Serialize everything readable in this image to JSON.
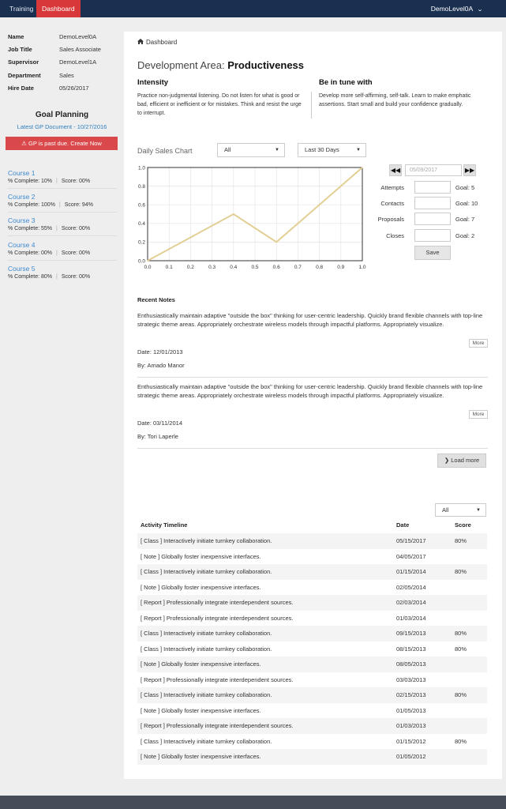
{
  "nav": {
    "tabs": [
      "Training",
      "Dashboard"
    ],
    "user": "DemoLevel0A"
  },
  "profile": [
    {
      "label": "Name",
      "value": "DemoLevel0A"
    },
    {
      "label": "Job Title",
      "value": "Sales Associate"
    },
    {
      "label": "Supervisor",
      "value": "DemoLevel1A"
    },
    {
      "label": "Department",
      "value": "Sales"
    },
    {
      "label": "Hire Date",
      "value": "05/26/2017"
    }
  ],
  "goal_planning": {
    "title": "Goal Planning",
    "latest_doc": "Latest GP Document - 10/27/2016",
    "alert": "GP is past due. Create Now"
  },
  "courses": [
    {
      "name": "Course 1",
      "complete": "% Complete: 10%",
      "score": "Score: 00%"
    },
    {
      "name": "Course 2",
      "complete": "% Complete: 100%",
      "score": "Score: 94%"
    },
    {
      "name": "Course 3",
      "complete": "% Complete: 55%",
      "score": "Score: 00%"
    },
    {
      "name": "Course 4",
      "complete": "% Complete: 00%",
      "score": "Score: 00%"
    },
    {
      "name": "Course 5",
      "complete": "% Complete: 80%",
      "score": "Score: 00%"
    }
  ],
  "breadcrumb": "Dashboard",
  "dev_area": {
    "prefix": "Development Area:",
    "name": "Productiveness"
  },
  "columns": [
    {
      "heading": "Intensity",
      "text": "Practice non-judgmental listening. Do not listen for what is good or bad, efficient or inefficient or for mistakes. Think and resist the urge to interrupt."
    },
    {
      "heading": "Be in tune with",
      "text": "Develop more self-affirming, self-talk. Learn to make emphatic assertions. Start small and build your confidence gradually."
    }
  ],
  "chart_panel": {
    "title": "Daily Sales Chart",
    "filter_value": "All",
    "range_value": "Last 30 Days"
  },
  "chart_data": {
    "type": "line",
    "x": [
      0.0,
      0.4,
      0.6,
      1.0
    ],
    "series": [
      {
        "values": [
          0.0,
          0.5,
          0.2,
          1.0
        ],
        "color": "#e2cf94"
      }
    ],
    "xticks": [
      "0.0",
      "0.1",
      "0.2",
      "0.3",
      "0.4",
      "0.5",
      "0.6",
      "0.7",
      "0.8",
      "0.9",
      "1.0"
    ],
    "yticks": [
      "0.0",
      "0.2",
      "0.4",
      "0.6",
      "0.8",
      "1.0"
    ],
    "xlim": [
      0,
      1
    ],
    "ylim": [
      0,
      1
    ],
    "grid": true
  },
  "goals": {
    "date": "05/09/2017",
    "rows": [
      {
        "label": "Attempts",
        "goal": "Goal: 5"
      },
      {
        "label": "Contacts",
        "goal": "Goal: 10"
      },
      {
        "label": "Proposals",
        "goal": "Goal: 7"
      },
      {
        "label": "Closes",
        "goal": "Goal: 2"
      }
    ],
    "save_label": "Save"
  },
  "notes": {
    "title": "Recent Notes",
    "items": [
      {
        "text": "Enthusiastically maintain adaptive \"outside the box\" thinking for user-centric leadership. Quickly brand flexible channels with top-line strategic theme areas. Appropriately orchestrate wireless models through impactful platforms. Appropriately visualize.",
        "date": "Date: 12/01/2013",
        "by": "By: Amado Manor"
      },
      {
        "text": "Enthusiastically maintain adaptive \"outside the box\" thinking for user-centric leadership. Quickly brand flexible channels with top-line strategic theme areas. Appropriately orchestrate wireless models through impactful platforms. Appropriately visualize.",
        "date": "Date: 03/11/2014",
        "by": "By: Tori Laperle"
      }
    ],
    "more_label": "More",
    "load_more_label": "Load more"
  },
  "timeline": {
    "filter_value": "All",
    "headers": [
      "Activity Timeline",
      "Date",
      "Score"
    ],
    "rows": [
      [
        "[ Class ] Interactively initiate turnkey collaboration.",
        "05/15/2017",
        "80%"
      ],
      [
        "[ Note ] Globally foster inexpensive interfaces.",
        "04/05/2017",
        ""
      ],
      [
        "[ Class ] Interactively initiate turnkey collaboration.",
        "01/15/2014",
        "80%"
      ],
      [
        "[ Note ] Globally foster inexpensive interfaces.",
        "02/05/2014",
        ""
      ],
      [
        "[ Report ] Professionally integrate interdependent sources.",
        "02/03/2014",
        ""
      ],
      [
        "[ Report ] Professionally integrate interdependent sources.",
        "01/03/2014",
        ""
      ],
      [
        "[ Class ] Interactively initiate turnkey collaboration.",
        "09/15/2013",
        "80%"
      ],
      [
        "[ Class ] Interactively initiate turnkey collaboration.",
        "08/15/2013",
        "80%"
      ],
      [
        "[ Note ] Globally foster inexpensive interfaces.",
        "08/05/2013",
        ""
      ],
      [
        "[ Report ] Professionally integrate interdependent sources.",
        "03/03/2013",
        ""
      ],
      [
        "[ Class ] Interactively initiate turnkey collaboration.",
        "02/15/2013",
        "80%"
      ],
      [
        "[ Note ] Globally foster inexpensive interfaces.",
        "01/05/2013",
        ""
      ],
      [
        "[ Report ] Professionally integrate interdependent sources.",
        "01/03/2013",
        ""
      ],
      [
        "[ Class ] Interactively initiate turnkey collaboration.",
        "01/15/2012",
        "80%"
      ],
      [
        "[ Note ] Globally foster inexpensive interfaces.",
        "01/05/2012",
        ""
      ]
    ]
  },
  "colors": {
    "nav_bg": "#1a3050",
    "nav_active": "#d9383a",
    "alert": "#d9484a",
    "link": "#2d7fc0",
    "chart_line": "#e2cf94",
    "footer": "#454d58"
  }
}
